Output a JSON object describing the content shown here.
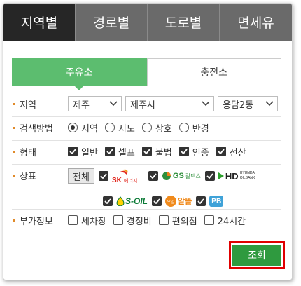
{
  "top_tabs": [
    "지역별",
    "경로별",
    "도로별",
    "면세유"
  ],
  "sub_tabs": [
    "주유소",
    "충전소"
  ],
  "region": {
    "label": "지역",
    "selects": [
      "제주",
      "제주시",
      "용담2동"
    ]
  },
  "search_method": {
    "label": "검색방법",
    "options": [
      "지역",
      "지도",
      "상호",
      "반경"
    ],
    "selected": "지역"
  },
  "type": {
    "label": "형태",
    "options": [
      "일반",
      "셀프",
      "불법",
      "인증",
      "전산"
    ]
  },
  "brand": {
    "label": "상표",
    "all_label": "전체",
    "logos": {
      "sk_text": "SK",
      "sk_sub": "에너지",
      "gs_text": "GS",
      "gs_sub": "칼텍스",
      "hd_text": "HD",
      "hd_sub1": "HYUNDAI",
      "hd_sub2": "OILBANK",
      "soil_text": "S-OIL",
      "alddeul_text": "알뜰",
      "alddeul_icon": "오일",
      "pb_text": "PB"
    },
    "colors": {
      "sk_red": "#e1251b",
      "sk_orange": "#f39a1f",
      "gs_green": "#2f8f3c",
      "gs_orange": "#f07f1b",
      "hd_green": "#2ca02c",
      "soil_yellow": "#ffd200",
      "soil_green": "#0b7a36",
      "alddeul_orange": "#f08a1c",
      "pb_blue": "#3fa2d8"
    }
  },
  "extra": {
    "label": "부가정보",
    "options": [
      "세차장",
      "경정비",
      "편의점",
      "24시간"
    ]
  },
  "search_button": "조회",
  "colors": {
    "tab_active": "#262626",
    "tab_inactive": "#6a6a6a",
    "subtab_active": "#5cbd6f",
    "search_green": "#2f9a3f",
    "highlight_red": "#e00000",
    "bullet": "#e08a2a"
  }
}
